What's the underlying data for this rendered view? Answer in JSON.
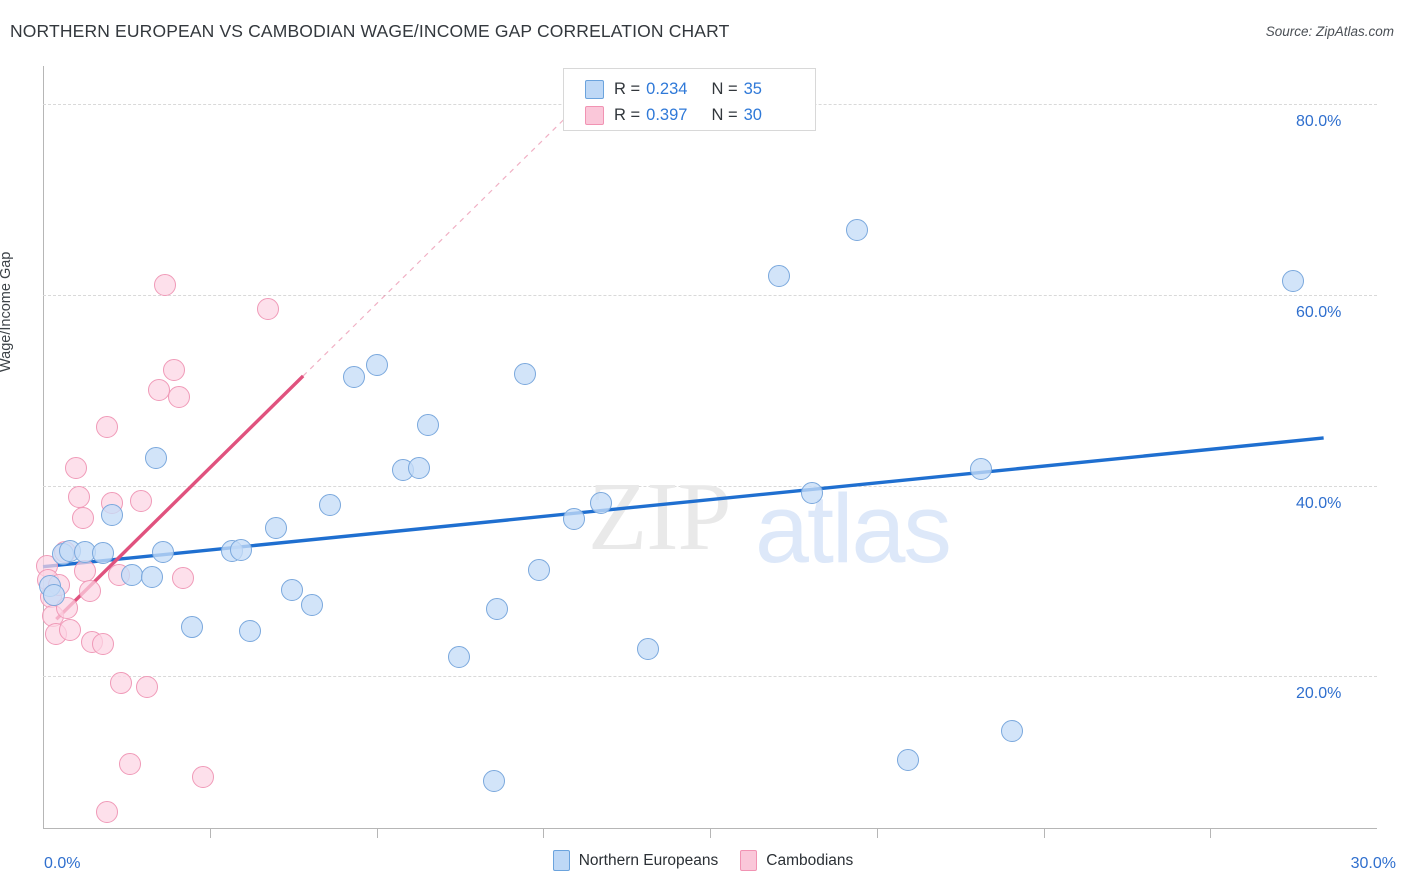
{
  "header": {
    "title": "NORTHERN EUROPEAN VS CAMBODIAN WAGE/INCOME GAP CORRELATION CHART",
    "source": "Source: ZipAtlas.com"
  },
  "watermark": {
    "part1": "ZIP",
    "part2": "atlas"
  },
  "stats": {
    "rows": [
      {
        "series": "Northern Europeans",
        "r_label": "R =",
        "r_value": "0.234",
        "n_label": "N =",
        "n_value": "35",
        "color": "#bed8f6"
      },
      {
        "series": "Cambodians",
        "r_label": "R =",
        "r_value": "0.397",
        "n_label": "N =",
        "n_value": "30",
        "color": "#fac7d9"
      }
    ]
  },
  "legend": {
    "items": [
      {
        "label": "Northern Europeans",
        "color": "#bed8f6"
      },
      {
        "label": "Cambodians",
        "color": "#fac7d9"
      }
    ]
  },
  "axes": {
    "ylabel": "Wage/Income Gap",
    "ytick_labels": [
      "80.0%",
      "60.0%",
      "40.0%",
      "20.0%"
    ],
    "x_min_label": "0.0%",
    "x_max_label": "30.0%"
  },
  "chart_data": {
    "type": "scatter",
    "title": "NORTHERN EUROPEAN VS CAMBODIAN WAGE/INCOME GAP CORRELATION CHART",
    "xlabel": "",
    "ylabel": "Wage/Income Gap",
    "xlim": [
      0,
      30
    ],
    "ylim": [
      4.0,
      84.0
    ],
    "xtick_values": [
      0,
      30
    ],
    "ytick_values": [
      80,
      60,
      40,
      20
    ],
    "grid": true,
    "legend_position": "bottom-center",
    "series": [
      {
        "name": "Northern Europeans",
        "color": "#bed8f6",
        "edge_color": "#7aa8dd",
        "R": 0.234,
        "N": 35,
        "trend": {
          "type": "linear",
          "x_start": 0.0,
          "y_start": 31.5,
          "x_end": 28.8,
          "y_end": 45.0,
          "color": "#1f6fd0"
        },
        "points": [
          {
            "x": 0.15,
            "y": 29.5
          },
          {
            "x": 0.25,
            "y": 28.5
          },
          {
            "x": 0.45,
            "y": 32.8
          },
          {
            "x": 0.6,
            "y": 33.2
          },
          {
            "x": 0.95,
            "y": 33.0
          },
          {
            "x": 1.35,
            "y": 32.9
          },
          {
            "x": 1.55,
            "y": 36.9
          },
          {
            "x": 2.0,
            "y": 30.6
          },
          {
            "x": 2.45,
            "y": 30.4
          },
          {
            "x": 2.55,
            "y": 42.9
          },
          {
            "x": 2.7,
            "y": 33.0
          },
          {
            "x": 3.35,
            "y": 25.2
          },
          {
            "x": 4.25,
            "y": 33.1
          },
          {
            "x": 4.45,
            "y": 33.3
          },
          {
            "x": 4.65,
            "y": 24.8
          },
          {
            "x": 5.25,
            "y": 35.6
          },
          {
            "x": 5.6,
            "y": 29.1
          },
          {
            "x": 6.05,
            "y": 27.5
          },
          {
            "x": 6.45,
            "y": 38.0
          },
          {
            "x": 7.0,
            "y": 51.4
          },
          {
            "x": 7.5,
            "y": 52.6
          },
          {
            "x": 8.65,
            "y": 46.4
          },
          {
            "x": 8.1,
            "y": 41.6
          },
          {
            "x": 8.45,
            "y": 41.9
          },
          {
            "x": 9.35,
            "y": 22.0
          },
          {
            "x": 10.2,
            "y": 27.1
          },
          {
            "x": 10.15,
            "y": 9.0
          },
          {
            "x": 10.85,
            "y": 51.7
          },
          {
            "x": 11.15,
            "y": 31.2
          },
          {
            "x": 11.95,
            "y": 36.5
          },
          {
            "x": 12.55,
            "y": 38.2
          },
          {
            "x": 13.6,
            "y": 22.9
          },
          {
            "x": 16.55,
            "y": 62.0
          },
          {
            "x": 17.3,
            "y": 39.2
          },
          {
            "x": 18.3,
            "y": 66.8
          },
          {
            "x": 21.1,
            "y": 41.7
          },
          {
            "x": 19.45,
            "y": 11.2
          },
          {
            "x": 21.8,
            "y": 14.3
          },
          {
            "x": 28.1,
            "y": 61.5
          }
        ]
      },
      {
        "name": "Cambodians",
        "color": "#fac7d9",
        "edge_color": "#f09ab8",
        "R": 0.397,
        "N": 30,
        "trend": {
          "type": "linear",
          "x_start": 0.3,
          "y_start": 26.0,
          "x_end": 5.85,
          "y_end": 51.5,
          "color": "#e0527e",
          "dashed_extension_to": {
            "x": 12.5,
            "y": 82.0
          }
        },
        "points": [
          {
            "x": 0.1,
            "y": 31.6
          },
          {
            "x": 0.12,
            "y": 30.1
          },
          {
            "x": 0.18,
            "y": 28.3
          },
          {
            "x": 0.22,
            "y": 26.3
          },
          {
            "x": 0.3,
            "y": 24.4
          },
          {
            "x": 0.35,
            "y": 29.6
          },
          {
            "x": 0.5,
            "y": 33.0
          },
          {
            "x": 0.55,
            "y": 27.2
          },
          {
            "x": 0.6,
            "y": 24.9
          },
          {
            "x": 0.75,
            "y": 41.8
          },
          {
            "x": 0.8,
            "y": 38.8
          },
          {
            "x": 0.9,
            "y": 36.6
          },
          {
            "x": 0.95,
            "y": 31.1
          },
          {
            "x": 1.05,
            "y": 29.0
          },
          {
            "x": 1.1,
            "y": 23.6
          },
          {
            "x": 1.35,
            "y": 23.4
          },
          {
            "x": 1.45,
            "y": 46.2
          },
          {
            "x": 1.55,
            "y": 38.2
          },
          {
            "x": 1.7,
            "y": 30.6
          },
          {
            "x": 1.75,
            "y": 19.3
          },
          {
            "x": 2.2,
            "y": 38.4
          },
          {
            "x": 2.6,
            "y": 50.0
          },
          {
            "x": 2.75,
            "y": 61.0
          },
          {
            "x": 2.95,
            "y": 52.1
          },
          {
            "x": 3.05,
            "y": 49.3
          },
          {
            "x": 3.15,
            "y": 30.3
          },
          {
            "x": 2.35,
            "y": 18.9
          },
          {
            "x": 1.95,
            "y": 10.8
          },
          {
            "x": 3.6,
            "y": 9.5
          },
          {
            "x": 1.45,
            "y": 5.8
          },
          {
            "x": 5.05,
            "y": 58.5
          }
        ]
      }
    ]
  }
}
